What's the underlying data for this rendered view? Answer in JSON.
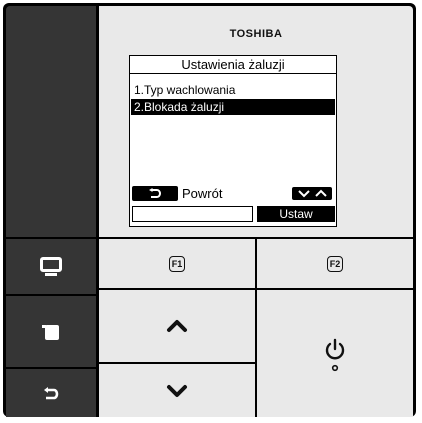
{
  "device": {
    "brand": "TOSHIBA"
  },
  "lcd": {
    "title": "Ustawienia żaluzji",
    "menu_items": [
      {
        "label": "1.Typ wachlowania",
        "selected": false
      },
      {
        "label": "2.Blokada żaluzji",
        "selected": true
      }
    ],
    "back_label": "Powrót",
    "f1_label": "",
    "f2_label": "Ustaw"
  },
  "buttons": {
    "f1": "F1",
    "f2": "F2"
  },
  "icons": {
    "monitor": "monitor-icon",
    "menu": "menu-icon",
    "back": "back-icon",
    "up": "chevron-up-icon",
    "down": "chevron-down-icon",
    "power": "power-icon"
  },
  "colors": {
    "frame": "#000000",
    "left_column": "#353535",
    "panel": "#e9e9e9",
    "lcd_bg": "#ffffff"
  }
}
